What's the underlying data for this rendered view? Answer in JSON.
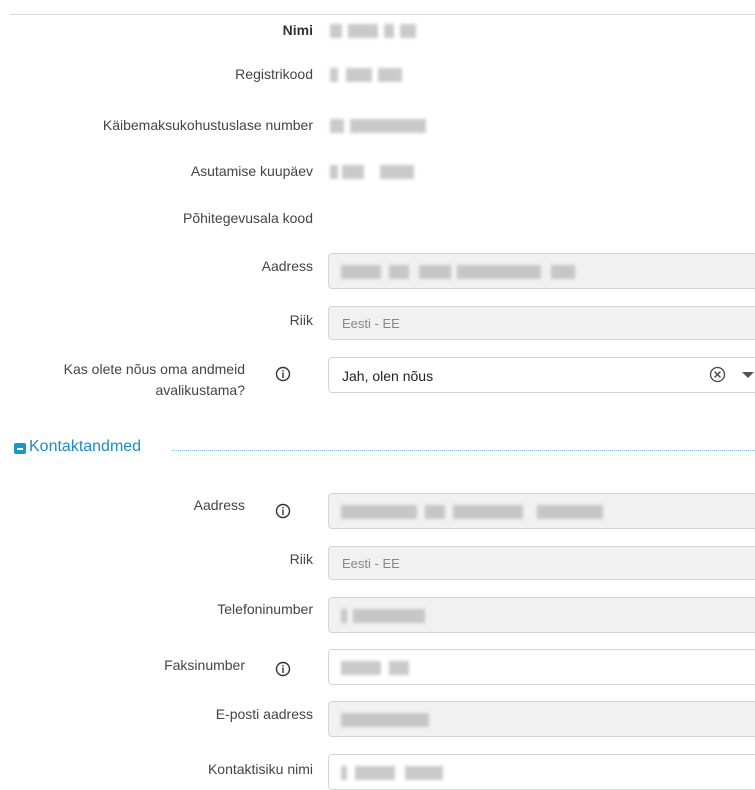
{
  "company": {
    "name_label": "Nimi",
    "regcode_label": "Registrikood",
    "vat_label": "Käibemaksukohustuslase number",
    "founded_label": "Asutamise kuupäev",
    "activity_label": "Põhitegevusala kood",
    "address_label": "Aadress",
    "country_label": "Riik",
    "country_value": "Eesti - EE",
    "consent_label": "Kas olete nõus oma andmeid avalikustama?",
    "consent_value": "Jah, olen nõus"
  },
  "contact": {
    "section_title": "Kontaktandmed",
    "address_label": "Aadress",
    "country_label": "Riik",
    "country_value": "Eesti - EE",
    "phone_label": "Telefoninumber",
    "fax_label": "Faksinumber",
    "email_label": "E-posti aadress",
    "contact_person_label": "Kontaktisiku nimi"
  },
  "icons": {
    "info": "info-circle-icon",
    "clear": "clear-circle-x-icon",
    "caret": "caret-down-icon",
    "collapse": "minus-square-icon"
  },
  "colors": {
    "accent": "#1a8ec2",
    "field_bg": "#f1f1f1",
    "border": "#d5d5d5"
  }
}
